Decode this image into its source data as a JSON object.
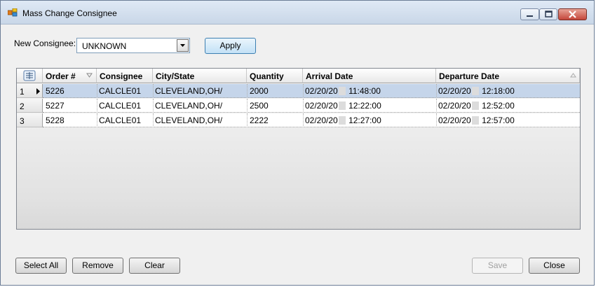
{
  "window": {
    "title": "Mass Change Consignee",
    "icon": "app-icon"
  },
  "form": {
    "new_consignee_label": "New Consignee:",
    "consignee_value": "UNKNOWN",
    "apply_label": "Apply"
  },
  "grid": {
    "columns": [
      "Order #",
      "Consignee",
      "City/State",
      "Quantity",
      "Arrival Date",
      "Departure Date"
    ],
    "rows": [
      {
        "num": "1",
        "order": "5226",
        "consignee": "CALCLE01",
        "city": "CLEVELAND,OH/",
        "qty": "2000",
        "arr_date": "02/20/20",
        "arr_time": "11:48:00",
        "dep_date": "02/20/20",
        "dep_time": "12:18:00"
      },
      {
        "num": "2",
        "order": "5227",
        "consignee": "CALCLE01",
        "city": "CLEVELAND,OH/",
        "qty": "2500",
        "arr_date": "02/20/20",
        "arr_time": "12:22:00",
        "dep_date": "02/20/20",
        "dep_time": "12:52:00"
      },
      {
        "num": "3",
        "order": "5228",
        "consignee": "CALCLE01",
        "city": "CLEVELAND,OH/",
        "qty": "2222",
        "arr_date": "02/20/20",
        "arr_time": "12:27:00",
        "dep_date": "02/20/20",
        "dep_time": "12:57:00"
      }
    ]
  },
  "buttons": {
    "select_all": "Select All",
    "remove": "Remove",
    "clear": "Clear",
    "save": "Save",
    "close": "Close"
  }
}
